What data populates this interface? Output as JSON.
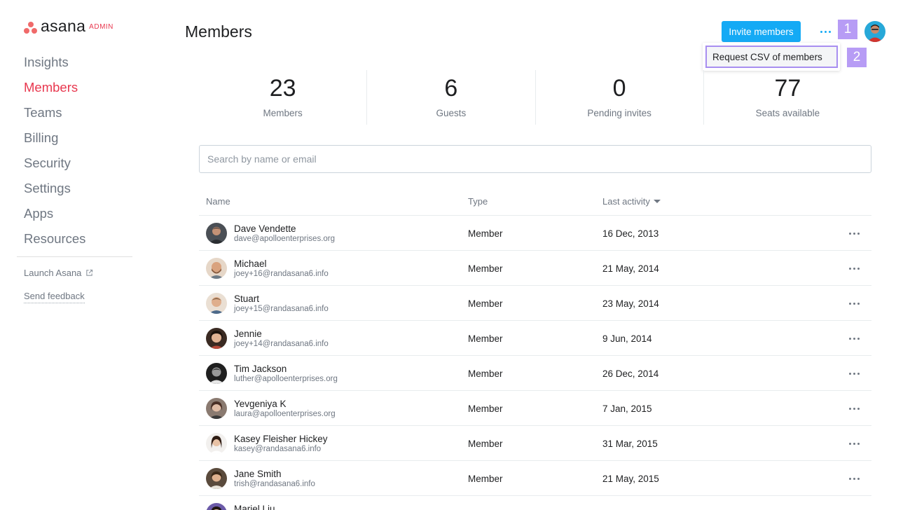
{
  "brand": {
    "name": "asana",
    "badge": "ADMIN",
    "accent": "#e8384f",
    "dots": "#f06a6a"
  },
  "sidebar": {
    "items": [
      {
        "label": "Insights",
        "active": false
      },
      {
        "label": "Members",
        "active": true
      },
      {
        "label": "Teams",
        "active": false
      },
      {
        "label": "Billing",
        "active": false
      },
      {
        "label": "Security",
        "active": false
      },
      {
        "label": "Settings",
        "active": false
      },
      {
        "label": "Apps",
        "active": false
      },
      {
        "label": "Resources",
        "active": false
      }
    ],
    "launch_label": "Launch Asana",
    "launch_icon": "external-link-icon",
    "feedback_label": "Send feedback"
  },
  "header": {
    "title": "Members",
    "invite_label": "Invite members",
    "invite_color": "#14aaf5",
    "more_icon": "more-horizontal-icon",
    "marker_1": "1",
    "marker_2": "2"
  },
  "dropdown": {
    "item_label": "Request CSV of members"
  },
  "stats": [
    {
      "value": "23",
      "label": "Members"
    },
    {
      "value": "6",
      "label": "Guests"
    },
    {
      "value": "0",
      "label": "Pending invites"
    },
    {
      "value": "77",
      "label": "Seats available"
    }
  ],
  "search": {
    "placeholder": "Search by name or email",
    "value": ""
  },
  "table": {
    "columns": {
      "name": "Name",
      "type": "Type",
      "activity": "Last activity"
    },
    "sort_icon": "caret-down-icon",
    "rows": [
      {
        "name": "Dave Vendette",
        "email": "dave@apolloenterprises.org",
        "type": "Member",
        "last_activity": "16 Dec, 2013"
      },
      {
        "name": "Michael",
        "email": "joey+16@randasana6.info",
        "type": "Member",
        "last_activity": "21 May, 2014"
      },
      {
        "name": "Stuart",
        "email": "joey+15@randasana6.info",
        "type": "Member",
        "last_activity": "23 May, 2014"
      },
      {
        "name": "Jennie",
        "email": "joey+14@randasana6.info",
        "type": "Member",
        "last_activity": "9 Jun, 2014"
      },
      {
        "name": "Tim Jackson",
        "email": "luther@apolloenterprises.org",
        "type": "Member",
        "last_activity": "26 Dec, 2014"
      },
      {
        "name": "Yevgeniya K",
        "email": "laura@apolloenterprises.org",
        "type": "Member",
        "last_activity": "7 Jan, 2015"
      },
      {
        "name": "Kasey Fleisher Hickey",
        "email": "kasey@randasana6.info",
        "type": "Member",
        "last_activity": "31 Mar, 2015"
      },
      {
        "name": "Jane Smith",
        "email": "trish@randasana6.info",
        "type": "Member",
        "last_activity": "21 May, 2015"
      },
      {
        "name": "Mariel Liu",
        "email": "",
        "type": "",
        "last_activity": ""
      }
    ]
  }
}
